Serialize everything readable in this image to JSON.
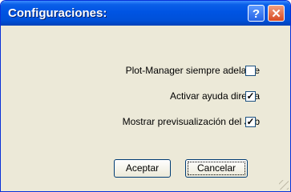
{
  "window": {
    "title": "Configuraciones:",
    "help_glyph": "?",
    "close_glyph": "✕"
  },
  "options": [
    {
      "label": "Plot-Manager siempre adelante",
      "checked": false,
      "mark": ""
    },
    {
      "label": "Activar ayuda directa",
      "checked": true,
      "mark": "✓"
    },
    {
      "label": "Mostrar previsualización del Job",
      "checked": true,
      "mark": "✓"
    }
  ],
  "buttons": {
    "accept": "Aceptar",
    "cancel": "Cancelar"
  },
  "colors": {
    "titlebar": "#0054e3",
    "window_bg": "#ece9d8",
    "close_button": "#d84a22"
  }
}
